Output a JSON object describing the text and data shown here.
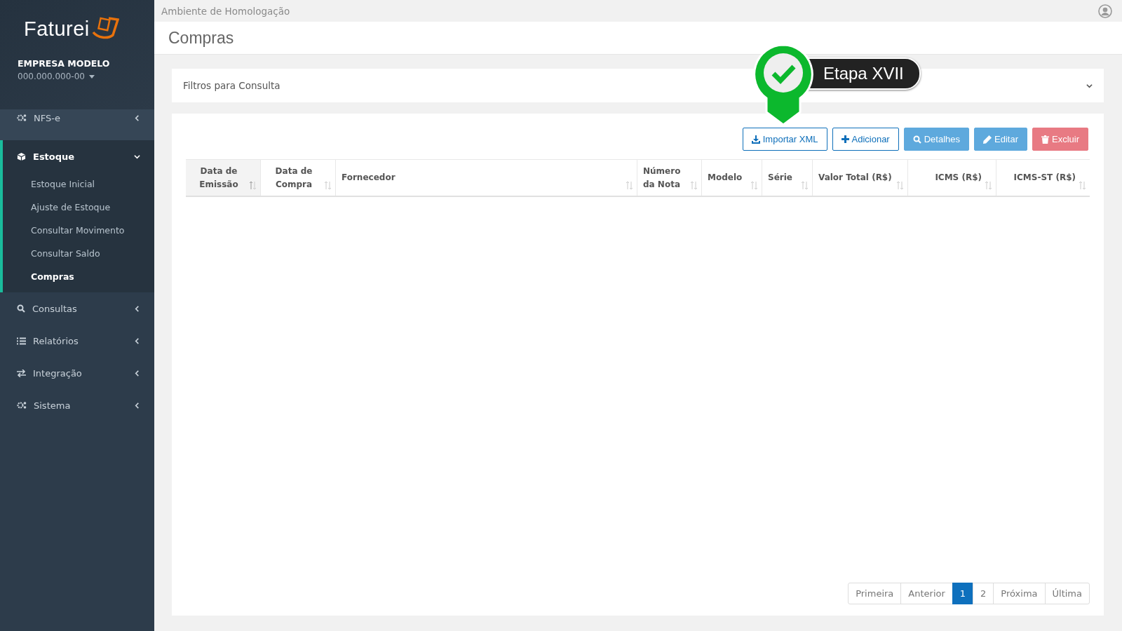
{
  "brand": {
    "name": "Faturei"
  },
  "company": {
    "name": "EMPRESA MODELO",
    "document": "000.000.000-00"
  },
  "environment": "Ambiente de Homologação",
  "page_title": "Compras",
  "nav": [
    {
      "label": "NFS-e",
      "expanded": false
    },
    {
      "label": "Estoque",
      "expanded": true,
      "children": [
        {
          "label": "Estoque Inicial",
          "selected": false
        },
        {
          "label": "Ajuste de Estoque",
          "selected": false
        },
        {
          "label": "Consultar Movimento",
          "selected": false
        },
        {
          "label": "Consultar Saldo",
          "selected": false
        },
        {
          "label": "Compras",
          "selected": true
        }
      ]
    },
    {
      "label": "Consultas",
      "expanded": false
    },
    {
      "label": "Relatórios",
      "expanded": false
    },
    {
      "label": "Integração",
      "expanded": false
    },
    {
      "label": "Sistema",
      "expanded": false
    }
  ],
  "filters": {
    "title": "Filtros para Consulta",
    "expanded": false
  },
  "callout": {
    "label": "Etapa XVII"
  },
  "actions": [
    {
      "label": "Importar XML",
      "kind": "outline"
    },
    {
      "label": "Adicionar",
      "kind": "outline"
    },
    {
      "label": "Detalhes",
      "kind": "info"
    },
    {
      "label": "Editar",
      "kind": "info"
    },
    {
      "label": "Excluir",
      "kind": "danger"
    }
  ],
  "table": {
    "columns": [
      {
        "label": "Data de Emissão",
        "sorted": true
      },
      {
        "label": "Data de Compra",
        "sorted": false
      },
      {
        "label": "Fornecedor",
        "sorted": false
      },
      {
        "label": "Número da Nota",
        "sorted": false
      },
      {
        "label": "Modelo",
        "sorted": false
      },
      {
        "label": "Série",
        "sorted": false
      },
      {
        "label": "Valor Total (R$)",
        "sorted": false
      },
      {
        "label": "ICMS (R$)",
        "sorted": false
      },
      {
        "label": "ICMS-ST (R$)",
        "sorted": false
      }
    ]
  },
  "pagination": [
    {
      "label": "Primeira",
      "selected": false
    },
    {
      "label": "Anterior",
      "selected": false
    },
    {
      "label": "1",
      "selected": true
    },
    {
      "label": "2",
      "selected": false
    },
    {
      "label": "Próxima",
      "selected": false
    },
    {
      "label": "Última",
      "selected": false
    }
  ]
}
